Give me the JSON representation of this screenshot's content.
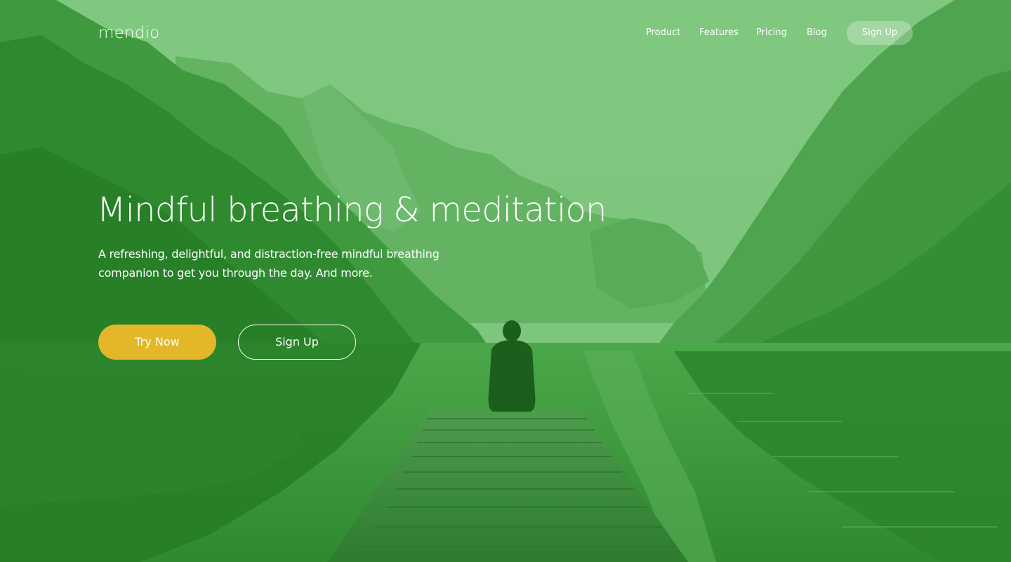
{
  "nav": {
    "logo": "mendio",
    "links": [
      {
        "label": "Product"
      },
      {
        "label": "Features"
      },
      {
        "label": "Pricing"
      },
      {
        "label": "Blog"
      }
    ],
    "signup_label": "Sign Up"
  },
  "hero": {
    "title": "Mindful breathing & meditation",
    "subtitle": "A refreshing, delightful, and distraction-free mindful breathing companion to get you through the day. And more.",
    "primary_button": "Try Now",
    "secondary_button": "Sign Up"
  },
  "colors": {
    "overlay_green": "#3f9f3f",
    "accent_yellow": "#e3b728",
    "text": "#ffffff"
  }
}
